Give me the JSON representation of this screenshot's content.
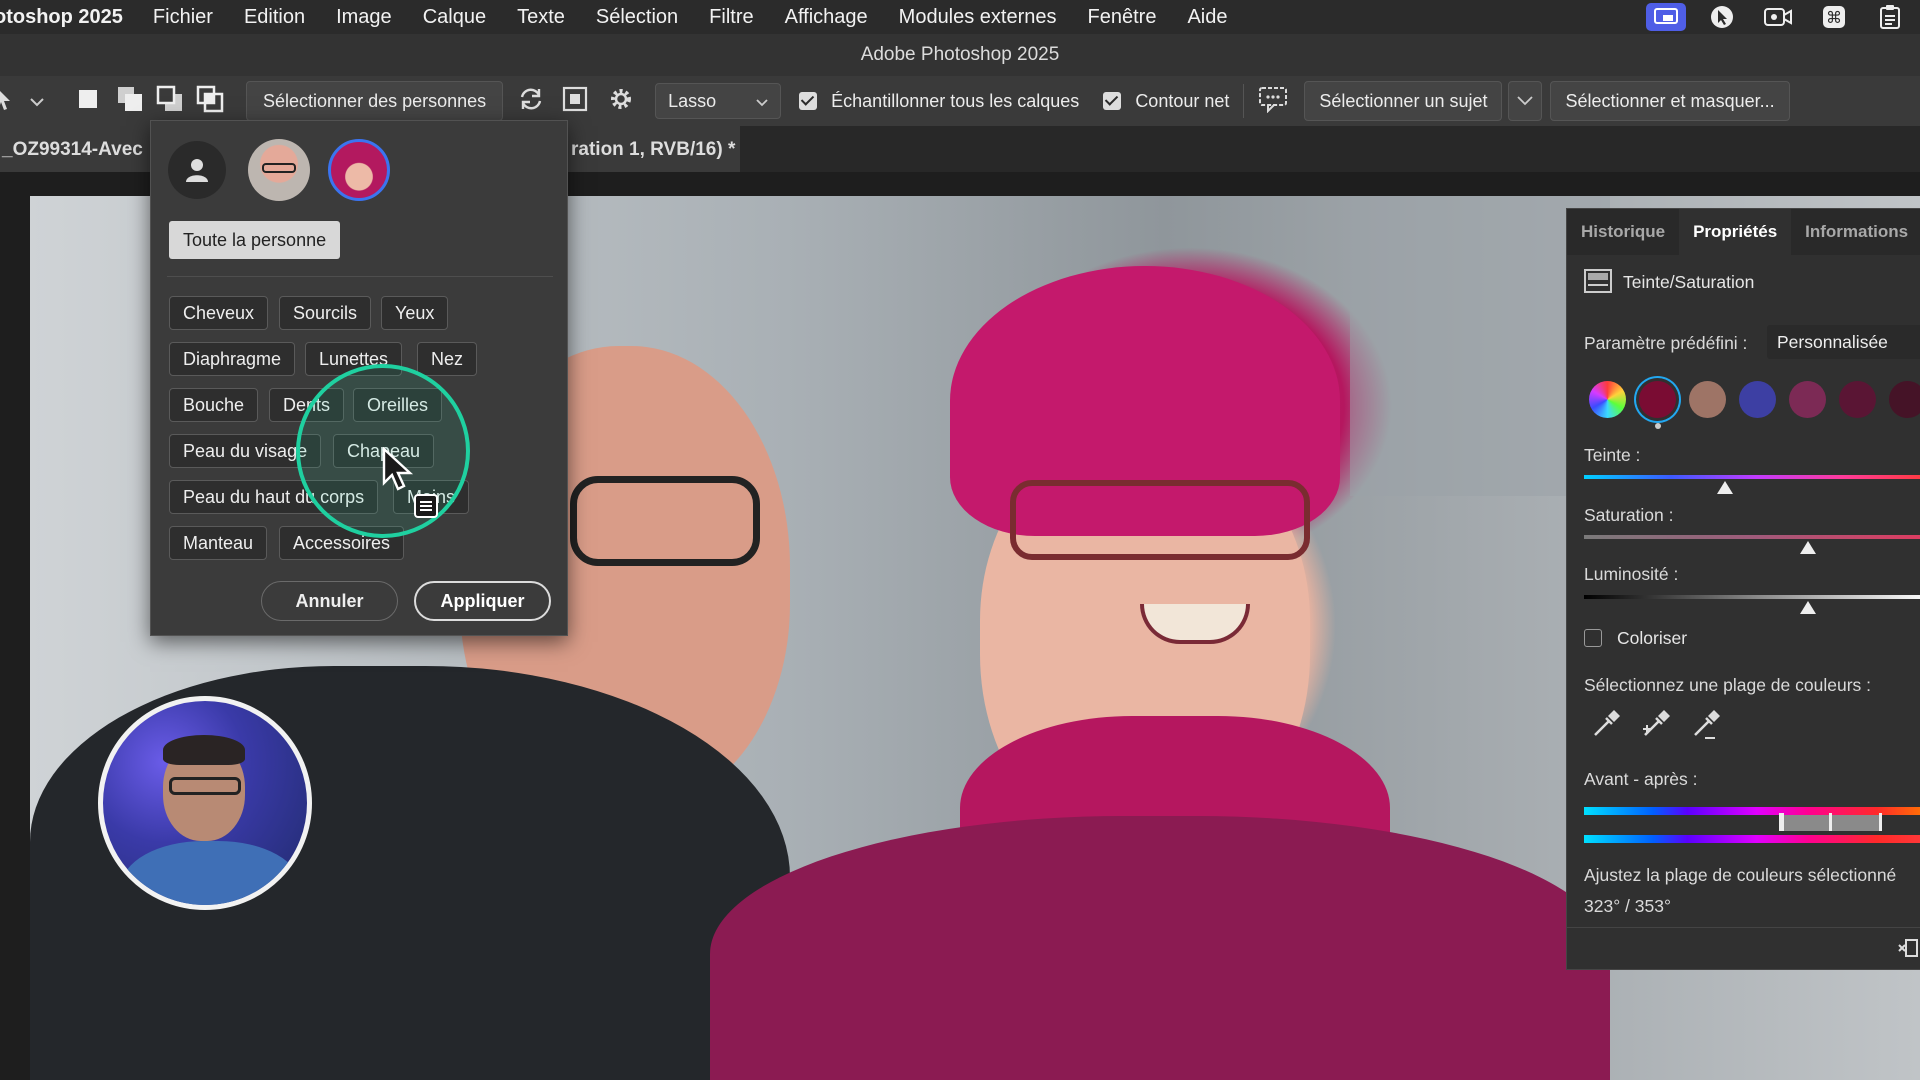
{
  "menubar": {
    "app_name": "otoshop 2025",
    "items": [
      "Fichier",
      "Edition",
      "Image",
      "Calque",
      "Texte",
      "Sélection",
      "Filtre",
      "Affichage",
      "Modules externes",
      "Fenêtre",
      "Aide"
    ]
  },
  "window_title": "Adobe Photoshop 2025",
  "options_bar": {
    "select_people_label": "Sélectionner des personnes",
    "lasso_value": "Lasso",
    "sample_all_layers_label": "Échantillonner tous les calques",
    "sample_all_layers_checked": true,
    "smooth_edge_label": "Contour net",
    "smooth_edge_checked": true,
    "select_subject_label": "Sélectionner un sujet",
    "select_and_mask_label": "Sélectionner et masquer..."
  },
  "document_tab": {
    "left_text": "_OZ99314-Avec",
    "right_text": "ration 1, RVB/16) *"
  },
  "people_picker": {
    "whole_person_label": "Toute la personne",
    "parts": [
      [
        "Cheveux",
        "Sourcils",
        "Yeux"
      ],
      [
        "Diaphragme",
        "Lunettes",
        "Nez"
      ],
      [
        "Bouche",
        "Dents",
        "Oreilles"
      ],
      [
        "Peau du visage",
        "Chapeau"
      ],
      [
        "Peau du haut du corps",
        "Mains"
      ],
      [
        "Manteau",
        "Accessoires"
      ]
    ],
    "cancel_label": "Annuler",
    "apply_label": "Appliquer"
  },
  "properties_panel": {
    "tabs": [
      "Historique",
      "Propriétés",
      "Informations"
    ],
    "active_tab": "Propriétés",
    "adjustment_title": "Teinte/Saturation",
    "preset_label": "Paramètre prédéfini :",
    "preset_value": "Personnalisée",
    "swatch_colors": [
      "#7a0c33",
      "#9e7466",
      "#3d3fa3",
      "#7c2a55",
      "#5a1534",
      "#451327"
    ],
    "hue_label": "Teinte :",
    "saturation_label": "Saturation :",
    "lightness_label": "Luminosité :",
    "hue_level": 0.41,
    "saturation_level": 0.65,
    "lightness_level": 0.65,
    "colorize_label": "Coloriser",
    "colorize_checked": false,
    "color_range_label": "Sélectionnez une plage de couleurs :",
    "before_after_label": "Avant - après :",
    "adjust_range_label": "Ajustez la plage de couleurs sélectionné",
    "range_value": "323° / 353°"
  },
  "accent_colors": {
    "focus_ring": "#1fd0a0",
    "active_tray": "#4f5ee6",
    "swatch_selected_ring": "#22a7f0"
  }
}
